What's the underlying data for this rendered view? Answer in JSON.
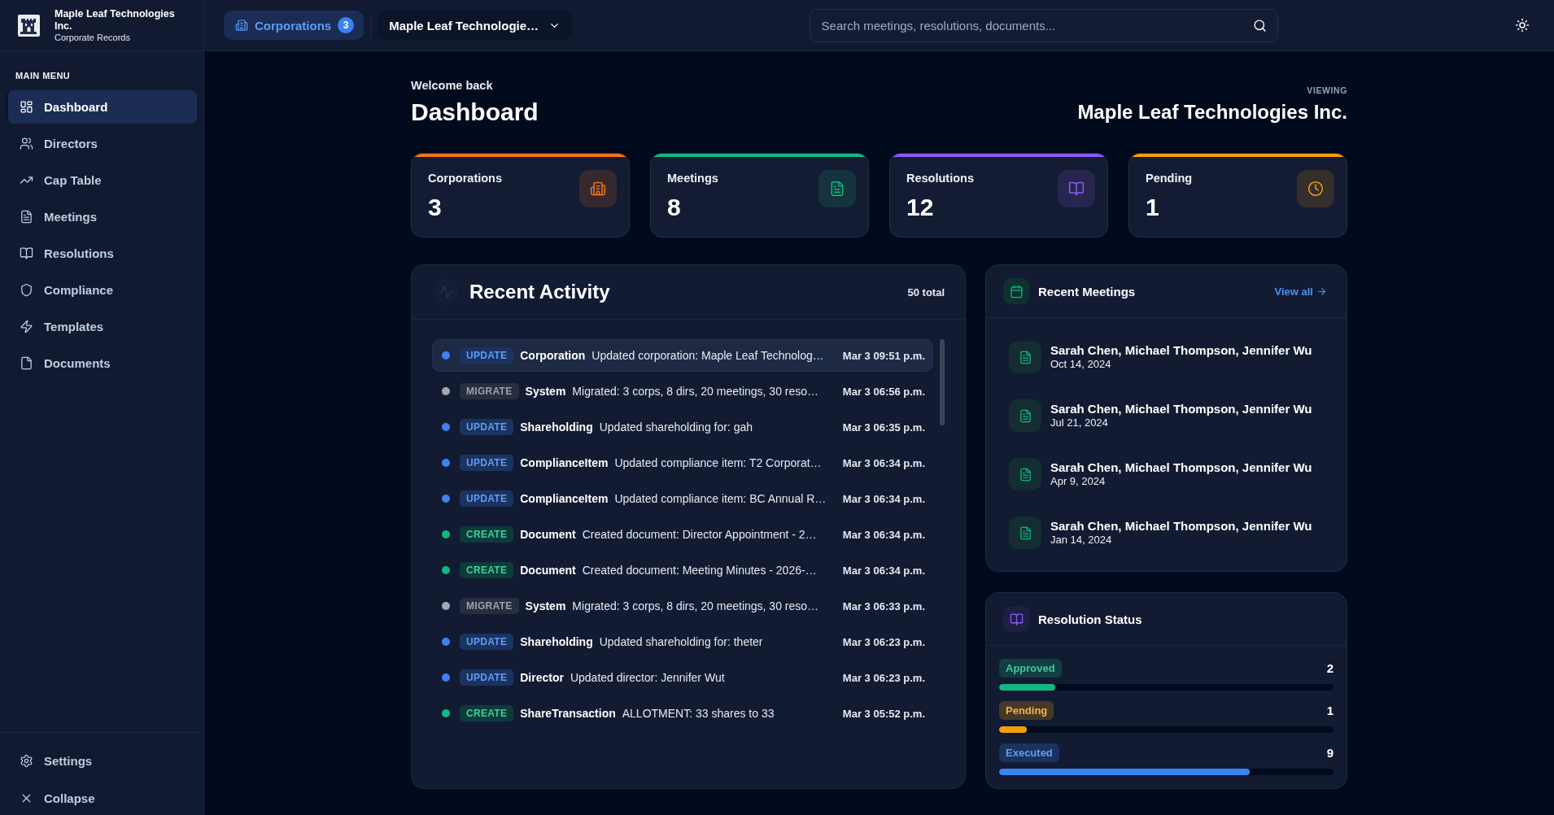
{
  "sidebar": {
    "brand": {
      "name": "Maple Leaf Technologies Inc.",
      "subtitle": "Corporate Records"
    },
    "section_label": "MAIN MENU",
    "items": [
      {
        "label": "Dashboard",
        "selected": true
      },
      {
        "label": "Directors",
        "selected": false
      },
      {
        "label": "Cap Table",
        "selected": false
      },
      {
        "label": "Meetings",
        "selected": false
      },
      {
        "label": "Resolutions",
        "selected": false
      },
      {
        "label": "Compliance",
        "selected": false
      },
      {
        "label": "Templates",
        "selected": false
      },
      {
        "label": "Documents",
        "selected": false
      }
    ],
    "footer_items": [
      {
        "label": "Settings"
      },
      {
        "label": "Collapse"
      }
    ]
  },
  "top_bar": {
    "corporations_button": {
      "label": "Corporations",
      "count": "3"
    },
    "corporation_select": {
      "value": "Maple Leaf Technologie…"
    },
    "search": {
      "placeholder": "Search meetings, resolutions, documents..."
    }
  },
  "header": {
    "greeting": "Welcome back",
    "title": "Dashboard",
    "viewing_label": "VIEWING",
    "viewing_value": "Maple Leaf Technologies Inc."
  },
  "stat_cards": [
    {
      "label": "Corporations",
      "value": "3",
      "color": "#f97316"
    },
    {
      "label": "Meetings",
      "value": "8",
      "color": "#10b981"
    },
    {
      "label": "Resolutions",
      "value": "12",
      "color": "#8b5cf6"
    },
    {
      "label": "Pending",
      "value": "1",
      "color": "#f59e0b"
    }
  ],
  "recent_activity": {
    "title": "Recent Activity",
    "total": "50 total",
    "rows": [
      {
        "kind": "update",
        "action": "UPDATE",
        "entity": "Corporation",
        "description": "Updated corporation: Maple Leaf Technolog…",
        "time": "Mar 3 09:51 p.m.",
        "selected": true
      },
      {
        "kind": "migrate",
        "action": "MIGRATE",
        "entity": "System",
        "description": "Migrated: 3 corps, 8 dirs, 20 meetings, 30 reso…",
        "time": "Mar 3 06:56 p.m.",
        "selected": false
      },
      {
        "kind": "update",
        "action": "UPDATE",
        "entity": "Shareholding",
        "description": "Updated shareholding for: gah",
        "time": "Mar 3 06:35 p.m.",
        "selected": false
      },
      {
        "kind": "update",
        "action": "UPDATE",
        "entity": "ComplianceItem",
        "description": "Updated compliance item: T2 Corporat…",
        "time": "Mar 3 06:34 p.m.",
        "selected": false
      },
      {
        "kind": "update",
        "action": "UPDATE",
        "entity": "ComplianceItem",
        "description": "Updated compliance item: BC Annual R…",
        "time": "Mar 3 06:34 p.m.",
        "selected": false
      },
      {
        "kind": "create",
        "action": "CREATE",
        "entity": "Document",
        "description": "Created document: Director Appointment - 2…",
        "time": "Mar 3 06:34 p.m.",
        "selected": false
      },
      {
        "kind": "create",
        "action": "CREATE",
        "entity": "Document",
        "description": "Created document: Meeting Minutes - 2026-…",
        "time": "Mar 3 06:34 p.m.",
        "selected": false
      },
      {
        "kind": "migrate",
        "action": "MIGRATE",
        "entity": "System",
        "description": "Migrated: 3 corps, 8 dirs, 20 meetings, 30 reso…",
        "time": "Mar 3 06:33 p.m.",
        "selected": false
      },
      {
        "kind": "update",
        "action": "UPDATE",
        "entity": "Shareholding",
        "description": "Updated shareholding for: theter",
        "time": "Mar 3 06:23 p.m.",
        "selected": false
      },
      {
        "kind": "update",
        "action": "UPDATE",
        "entity": "Director",
        "description": "Updated director: Jennifer Wut",
        "time": "Mar 3 06:23 p.m.",
        "selected": false
      },
      {
        "kind": "create",
        "action": "CREATE",
        "entity": "ShareTransaction",
        "description": "ALLOTMENT: 33 shares to 33",
        "time": "Mar 3 05:52 p.m.",
        "selected": false
      }
    ]
  },
  "recent_meetings": {
    "title": "Recent Meetings",
    "link": "View all",
    "items": [
      {
        "attendees": "Sarah Chen, Michael Thompson, Jennifer Wu",
        "date": "Oct 14, 2024"
      },
      {
        "attendees": "Sarah Chen, Michael Thompson, Jennifer Wu",
        "date": "Jul 21, 2024"
      },
      {
        "attendees": "Sarah Chen, Michael Thompson, Jennifer Wu",
        "date": "Apr 9, 2024"
      },
      {
        "attendees": "Sarah Chen, Michael Thompson, Jennifer Wu",
        "date": "Jan 14, 2024"
      }
    ]
  },
  "resolution_status": {
    "title": "Resolution Status",
    "items": [
      {
        "label": "Approved",
        "count": "2",
        "level": 0.167,
        "color": "#10b981"
      },
      {
        "label": "Pending",
        "count": "1",
        "level": 0.083,
        "color": "#f59e0b"
      },
      {
        "label": "Executed",
        "count": "9",
        "level": 0.75,
        "color": "#3b82f6"
      }
    ]
  }
}
